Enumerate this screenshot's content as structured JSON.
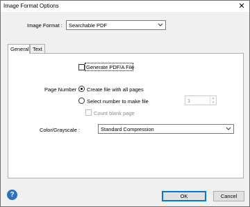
{
  "window": {
    "title": "Image Format Options",
    "close_glyph": "✕"
  },
  "image_format": {
    "label": "Image Format :",
    "value": "Searchable PDF"
  },
  "tabs": [
    {
      "label": "General"
    },
    {
      "label": "Text"
    }
  ],
  "general": {
    "pdfa_label": "Generate PDF/A File",
    "pdfa_checked": false,
    "page_number_label": "Page Number :",
    "opt_all_pages": "Create file with all pages",
    "opt_select_number": "Select number to make file",
    "selected_option": "opt_all_pages",
    "number_value": "1",
    "count_blank_label": "Count blank page",
    "color_label": "Color/Grayscale :",
    "color_value": "Standard Compression"
  },
  "footer": {
    "help_glyph": "?",
    "ok_label": "OK",
    "cancel_label": "Cancel"
  }
}
